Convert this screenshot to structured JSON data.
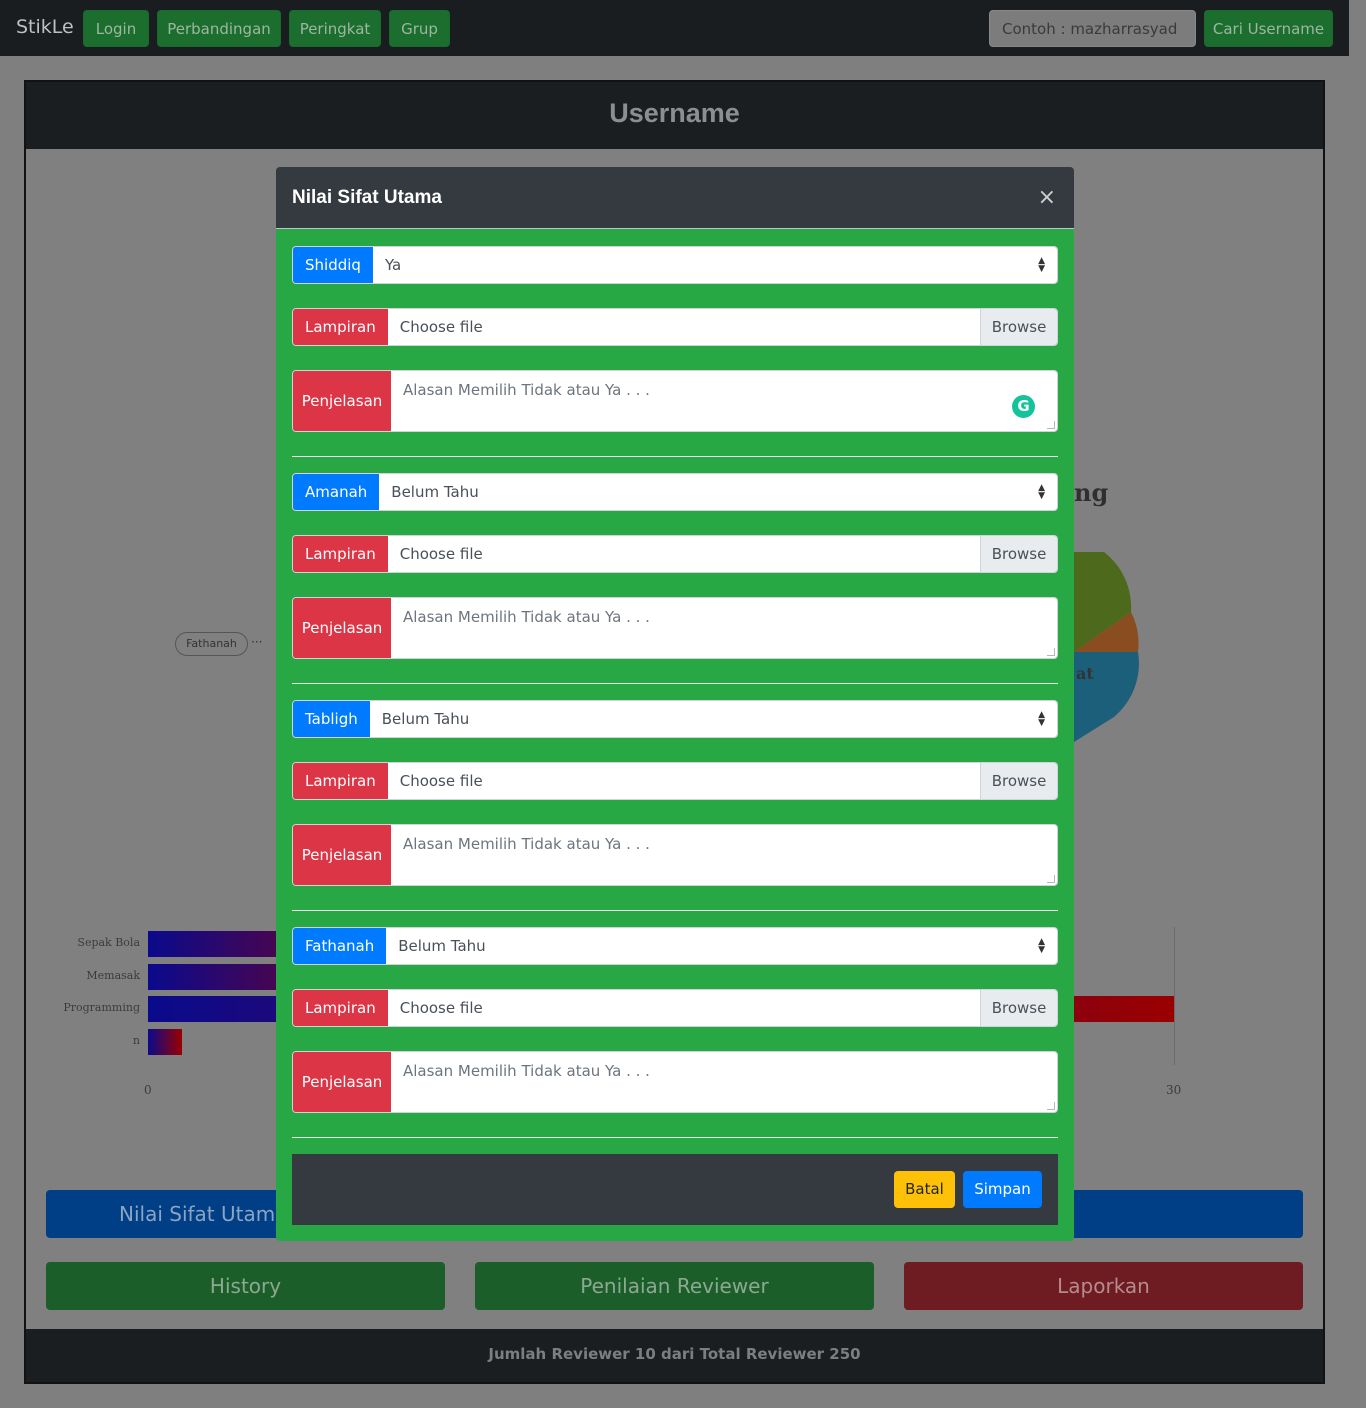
{
  "navbar": {
    "brand": "StikLe",
    "items": [
      {
        "label": "Login"
      },
      {
        "label": "Perbandingan"
      },
      {
        "label": "Peringkat"
      },
      {
        "label": "Grup"
      }
    ],
    "search": {
      "placeholder": "Contoh : mazharrasyad"
    },
    "search_button": "Cari Username"
  },
  "page": {
    "title": "Username",
    "background_fragments": {
      "pie_title_fragment": "ng",
      "pie_label_fragment": "at",
      "mind_node": "Fathanah",
      "mind_dots": "···"
    },
    "footer_text": "Jumlah Reviewer 10 dari Total Reviewer 250",
    "buttons": {
      "nilai_sifat_utama": "Nilai Sifat Utama",
      "history": "History",
      "penilaian_reviewer": "Penilaian Reviewer",
      "laporkan": "Laporkan"
    }
  },
  "chart_data": {
    "type": "bar",
    "orientation": "horizontal",
    "categories": [
      "Sepak Bola",
      "Memasak",
      "Programming",
      "n"
    ],
    "values": [
      9,
      9,
      30,
      1
    ],
    "x_ticks": [
      "0",
      "30"
    ],
    "xlim": [
      0,
      30
    ],
    "note_values_partially_occluded_by_modal": true,
    "colors": {
      "start": "#0a0a8c",
      "end": "#9a0000"
    }
  },
  "modal": {
    "title": "Nilai Sifat Utama",
    "close_label": "×",
    "sections": [
      {
        "trait": "Shiddiq",
        "selected": "Ya",
        "attachment_label": "Lampiran",
        "file_placeholder": "Choose file",
        "browse_label": "Browse",
        "explanation_label": "Penjelasan",
        "explanation_placeholder": "Alasan Memilih Tidak atau Ya . . ."
      },
      {
        "trait": "Amanah",
        "selected": "Belum Tahu",
        "attachment_label": "Lampiran",
        "file_placeholder": "Choose file",
        "browse_label": "Browse",
        "explanation_label": "Penjelasan",
        "explanation_placeholder": "Alasan Memilih Tidak atau Ya . . ."
      },
      {
        "trait": "Tabligh",
        "selected": "Belum Tahu",
        "attachment_label": "Lampiran",
        "file_placeholder": "Choose file",
        "browse_label": "Browse",
        "explanation_label": "Penjelasan",
        "explanation_placeholder": "Alasan Memilih Tidak atau Ya . . ."
      },
      {
        "trait": "Fathanah",
        "selected": "Belum Tahu",
        "attachment_label": "Lampiran",
        "file_placeholder": "Choose file",
        "browse_label": "Browse",
        "explanation_label": "Penjelasan",
        "explanation_placeholder": "Alasan Memilih Tidak atau Ya . . ."
      }
    ],
    "footer": {
      "cancel_label": "Batal",
      "save_label": "Simpan"
    }
  },
  "colors": {
    "primary": "#007bff",
    "success": "#28a745",
    "danger": "#dc3545",
    "warning": "#ffc107",
    "dark": "#343a40"
  }
}
